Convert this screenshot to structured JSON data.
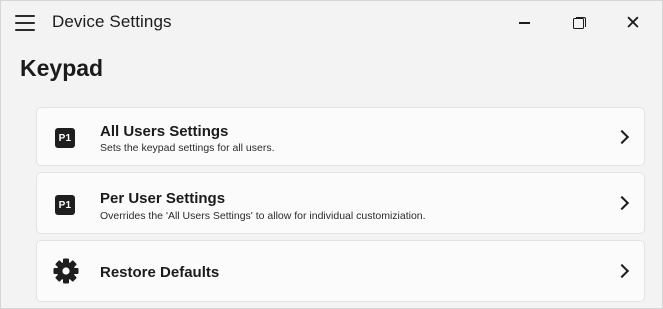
{
  "window": {
    "title": "Device Settings",
    "controls": {
      "minimize_icon": "minimize-icon",
      "maximize_icon": "maximize-icon",
      "close_icon": "close-icon",
      "close_glyph": "✕"
    }
  },
  "page": {
    "title": "Keypad"
  },
  "cards": [
    {
      "icon": "p1-icon",
      "badge": "P1",
      "title": "All Users Settings",
      "description": "Sets the keypad settings for all users."
    },
    {
      "icon": "p1-icon",
      "badge": "P1",
      "title": "Per User Settings",
      "description": "Overrides the 'All Users Settings' to allow for individual customiziation."
    },
    {
      "icon": "gear-icon",
      "title": "Restore Defaults"
    }
  ],
  "colors": {
    "background": "#f3f3f3",
    "card": "#fbfbfb",
    "card_border": "#e3e3e3",
    "badge": "#1e1e1e",
    "text": "#1b1b1b"
  }
}
